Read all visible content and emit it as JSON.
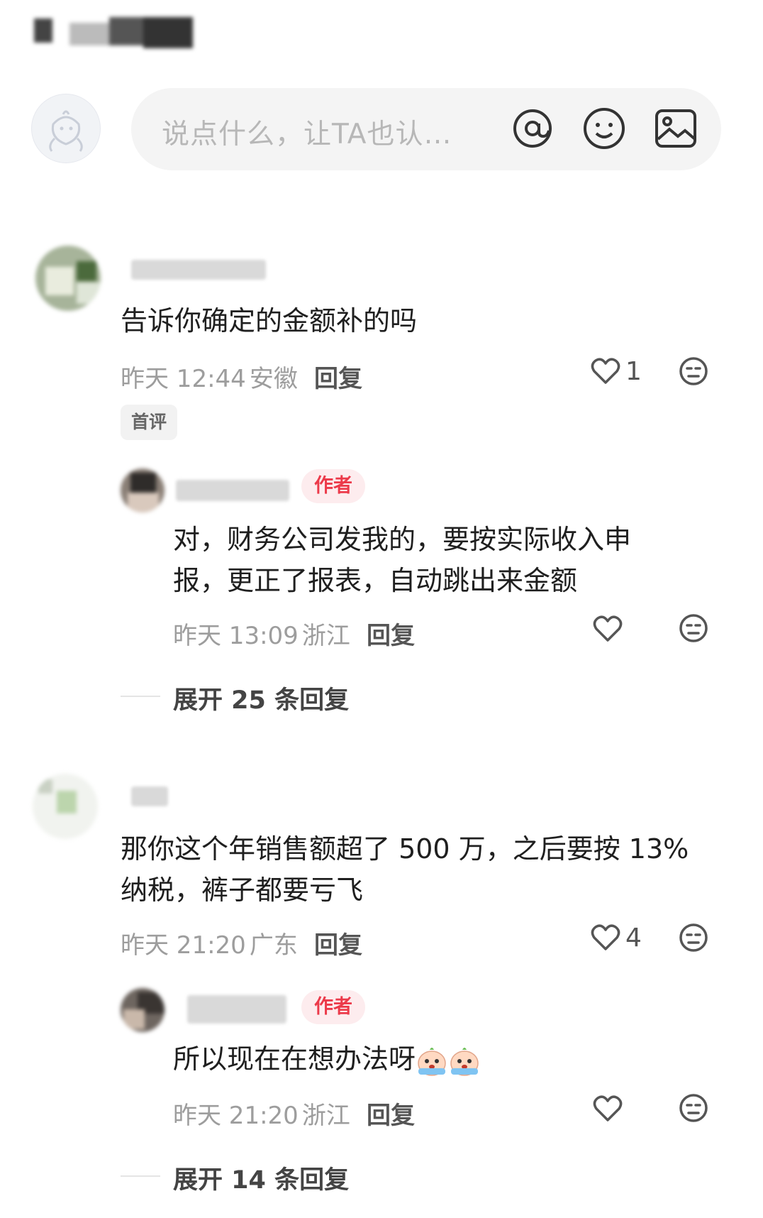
{
  "input": {
    "placeholder": "说点什么，让TA也认…"
  },
  "comments": [
    {
      "text": "告诉你确定的金额补的吗",
      "time": "昨天 12:44",
      "location": "安徽",
      "reply_label": "回复",
      "likes": "1",
      "badge": "首评",
      "replies": [
        {
          "badge": "作者",
          "text_lines": [
            "对，财务公司发我的，要按实际收入申",
            "报，更正了报表，自动跳出来金额"
          ],
          "time": "昨天 13:09",
          "location": "浙江",
          "reply_label": "回复"
        }
      ],
      "expand_label": "展开 25 条回复"
    },
    {
      "text_lines": [
        "那你这个年销售额超了 500 万，之后要按 13%",
        "纳税，裤子都要亏飞"
      ],
      "time": "昨天 21:20",
      "location": "广东",
      "reply_label": "回复",
      "likes": "4",
      "replies": [
        {
          "badge": "作者",
          "text": "所以现在在想办法呀",
          "time": "昨天 21:20",
          "location": "浙江",
          "reply_label": "回复"
        }
      ],
      "expand_label": "展开 14 条回复"
    }
  ],
  "colors": {
    "author_badge": "#ec3a4a",
    "meta_text": "#9d9d9d"
  },
  "icons": [
    "at-icon",
    "emoji-icon",
    "image-icon",
    "heart-icon",
    "dislike-face-icon",
    "crying-emoji-icon"
  ]
}
